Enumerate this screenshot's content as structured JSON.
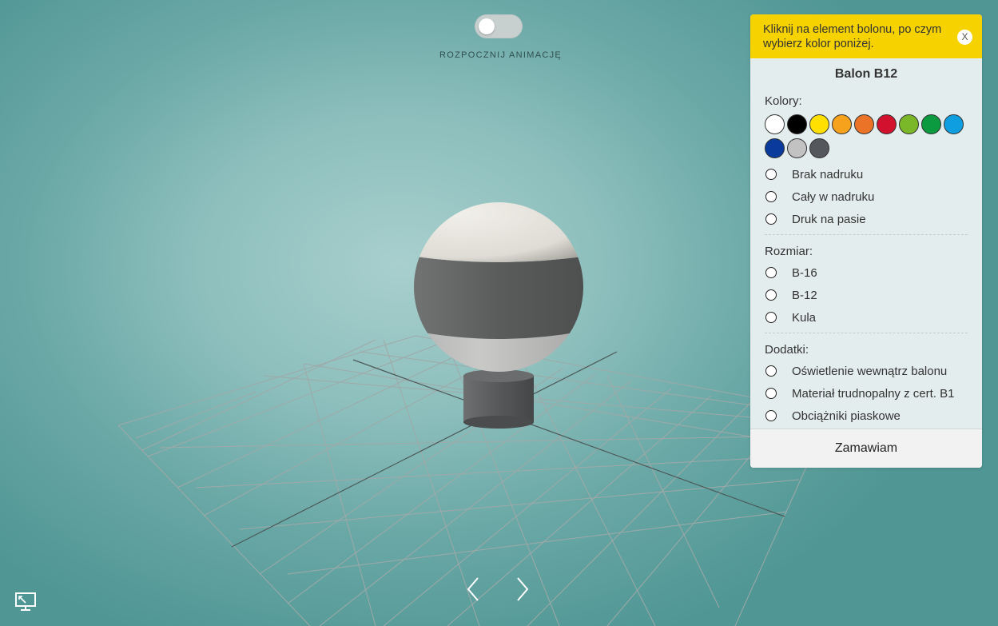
{
  "animation": {
    "label": "ROZPOCZNIJ ANIMACJĘ",
    "enabled": false
  },
  "icons": {
    "prev": "chevron-left-icon",
    "next": "chevron-right-icon",
    "screen": "monitor-icon",
    "close": "close-icon"
  },
  "panel": {
    "hint": "Kliknij na element bolonu, po czym wybierz kolor poniżej.",
    "close_label": "X",
    "title": "Balon B12",
    "colors_label": "Kolory:",
    "colors": [
      "#ffffff",
      "#000000",
      "#ffe000",
      "#f6a21d",
      "#ea7328",
      "#d2112e",
      "#7ab829",
      "#0b9a40",
      "#0f9fe0",
      "#0a3b9c",
      "#c2c2c2",
      "#54575b"
    ],
    "print_options": [
      "Brak nadruku",
      "Cały w nadruku",
      "Druk na pasie"
    ],
    "size_label": "Rozmiar:",
    "size_options": [
      "B-16",
      "B-12",
      "Kula"
    ],
    "extras_label": "Dodatki:",
    "extras_options": [
      "Oświetlenie wewnątrz balonu",
      "Materiał trudnopalny z cert. B1",
      "Obciążniki piaskowe"
    ],
    "order_label": "Zamawiam"
  },
  "balloon_colors": {
    "top": "#e4e2da",
    "band": "#5a5c5c",
    "bottom": "#bdbdbb",
    "base": "#4f5152"
  }
}
